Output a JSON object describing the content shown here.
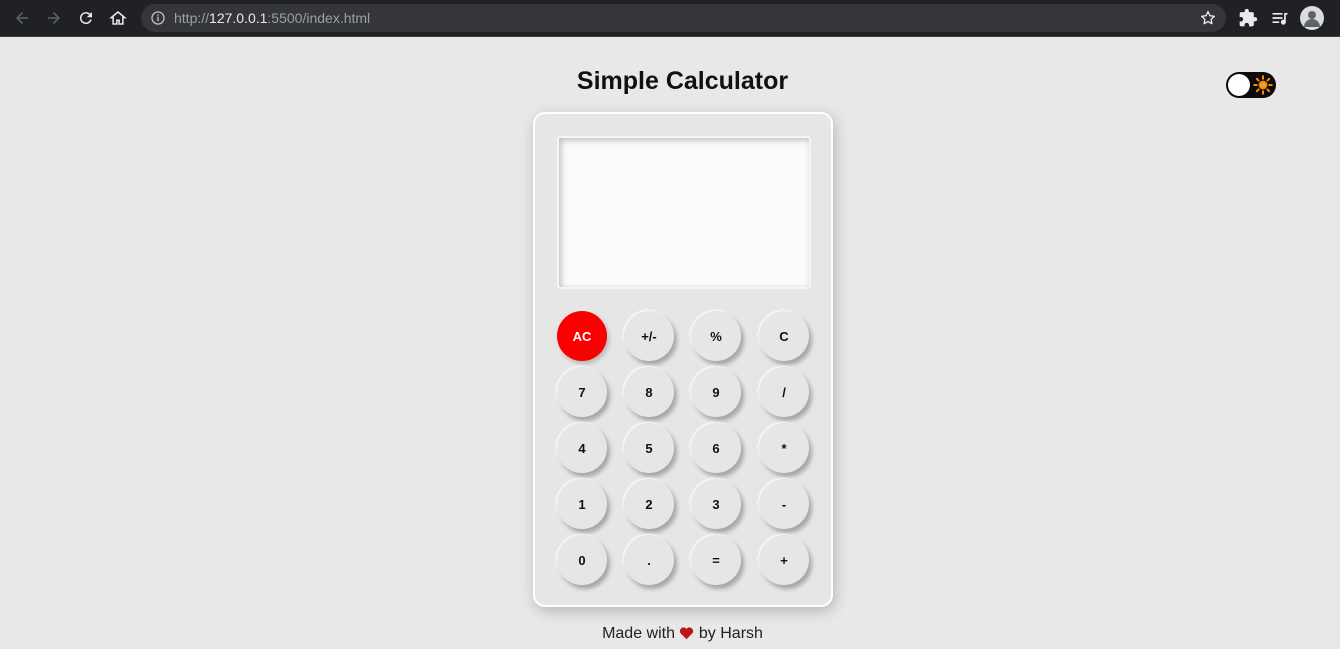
{
  "browser": {
    "url_scheme": "http://",
    "url_host": "127.0.0.1",
    "url_rest": ":5500/index.html"
  },
  "page": {
    "title": "Simple Calculator",
    "display_value": "",
    "theme_toggle_state": "light"
  },
  "keys": [
    [
      "AC",
      "+/-",
      "%",
      "C"
    ],
    [
      "7",
      "8",
      "9",
      "/"
    ],
    [
      "4",
      "5",
      "6",
      "*"
    ],
    [
      "1",
      "2",
      "3",
      "-"
    ],
    [
      "0",
      ".",
      "=",
      "+"
    ]
  ],
  "footer": {
    "prefix": "Made with",
    "suffix": "by Harsh"
  },
  "colors": {
    "ac_button": "#fb0000",
    "heart": "#c0141b",
    "sun": "#ff8c00"
  }
}
